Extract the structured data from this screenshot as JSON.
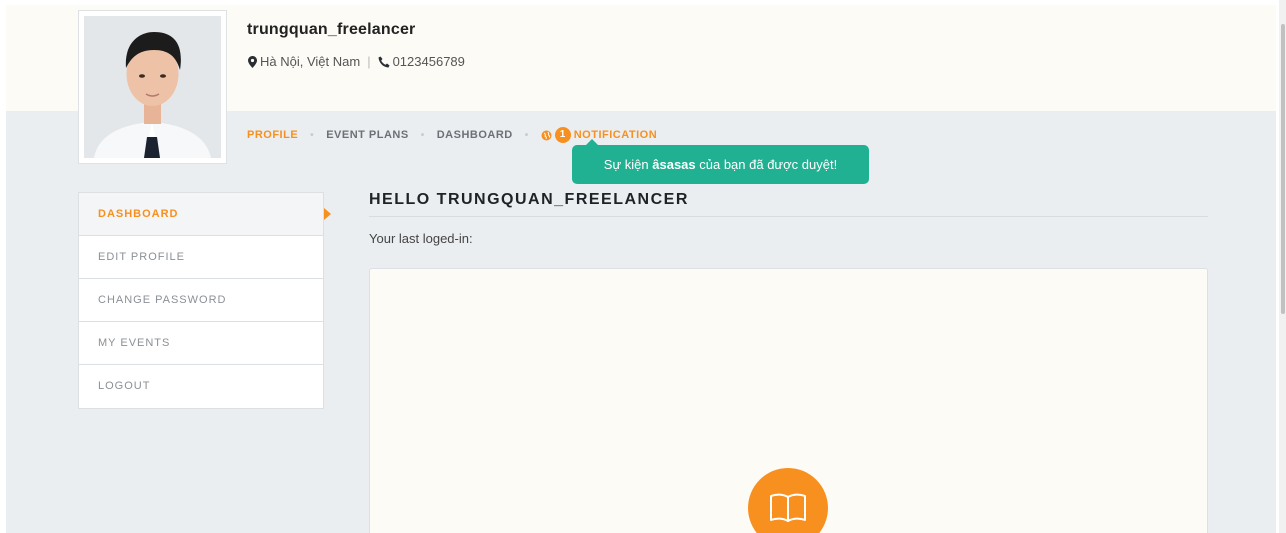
{
  "profile": {
    "username": "trungquan_freelancer",
    "location": "Hà Nội, Việt Nam",
    "phone": "0123456789"
  },
  "tabs": [
    {
      "label": "PROFILE",
      "active": true
    },
    {
      "label": "EVENT PLANS",
      "active": false
    },
    {
      "label": "DASHBOARD",
      "active": false
    },
    {
      "label": "NOTIFICATION",
      "active": false,
      "badge": "1"
    }
  ],
  "toast": {
    "prefix": "Sự kiện ",
    "event_name": "âsasas",
    "suffix": " của bạn đã được duyệt!"
  },
  "sidebar": {
    "items": [
      {
        "label": "DASHBOARD",
        "active": true
      },
      {
        "label": "EDIT PROFILE",
        "active": false
      },
      {
        "label": "CHANGE PASSWORD",
        "active": false
      },
      {
        "label": "MY EVENTS",
        "active": false
      },
      {
        "label": "LOGOUT",
        "active": false
      }
    ]
  },
  "main": {
    "heading": "HELLO TRUNGQUAN_FREELANCER",
    "last_login_label": "Your last loged-in:"
  },
  "colors": {
    "accent": "#f7901e",
    "toast_bg": "#20b092",
    "page_bg": "#eaeef1",
    "header_bg": "#fdfbf6"
  },
  "icons": {
    "location": "map-marker-icon",
    "phone": "phone-icon",
    "notification": "globe-icon",
    "panel": "book-icon"
  }
}
